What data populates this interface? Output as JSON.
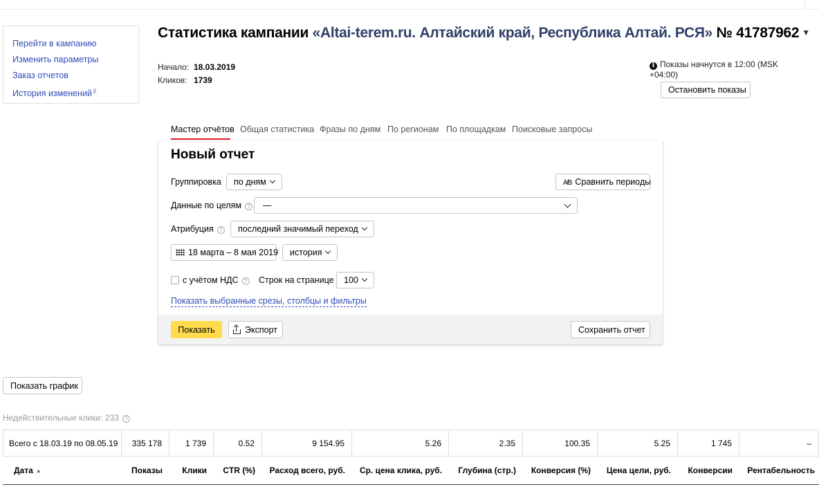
{
  "sidebar": {
    "items": [
      {
        "label": "Перейти в кампанию"
      },
      {
        "label": "Изменить параметры"
      },
      {
        "label": "Заказ отчетов"
      },
      {
        "label": "История изменений",
        "badge": "β"
      }
    ]
  },
  "header": {
    "title_prefix": "Статистика кампании",
    "campaign_name": "«Altai-terem.ru. Алтайский край, Республика Алтай. РСЯ»",
    "campaign_number": "№ 41787962",
    "start_label": "Начало:",
    "start_value": "18.03.2019",
    "clicks_label": "Кликов:",
    "clicks_value": "1739",
    "notice_text": "Показы начнутся в 12:00 (MSK +04:00)",
    "stop_button": "Остановить показы"
  },
  "tabs": [
    {
      "label": "Мастер отчётов",
      "active": true
    },
    {
      "label": "Общая статистика"
    },
    {
      "label": "Фразы по дням"
    },
    {
      "label": "По регионам"
    },
    {
      "label": "По площадкам"
    },
    {
      "label": "Поисковые запросы"
    }
  ],
  "report": {
    "title": "Новый отчет",
    "grouping_label": "Группировка",
    "grouping_value": "по дням",
    "compare_button": "Сравнить периоды",
    "goals_label": "Данные по целям",
    "goals_value": "—",
    "attribution_label": "Атрибуция",
    "attribution_value": "последний значимый переход",
    "date_range": "18 марта – 8 мая 2019",
    "history_value": "история",
    "vat_label": "с учётом НДС",
    "rows_label": "Строк на странице",
    "rows_value": "100",
    "show_selected_link": "Показать выбранные срезы, столбцы и фильтры",
    "show_button": "Показать",
    "export_button": "Экспорт",
    "save_button": "Сохранить отчет"
  },
  "show_chart_button": "Показать график",
  "invalid_clicks": "Недействительные клики: 233",
  "table": {
    "totals": [
      "Всего с 18.03.19 по 08.05.19",
      "335 178",
      "1 739",
      "0.52",
      "9 154.95",
      "5.26",
      "2.35",
      "100.35",
      "5.25",
      "1 745",
      "–"
    ],
    "headers": [
      "Дата",
      "Показы",
      "Клики",
      "CTR (%)",
      "Расход всего, руб.",
      "Ср. цена клика, руб.",
      "Глубина (стр.)",
      "Конверсия (%)",
      "Цена цели, руб.",
      "Конверсии",
      "Рентабельность"
    ],
    "sort_indicator": "▲"
  }
}
